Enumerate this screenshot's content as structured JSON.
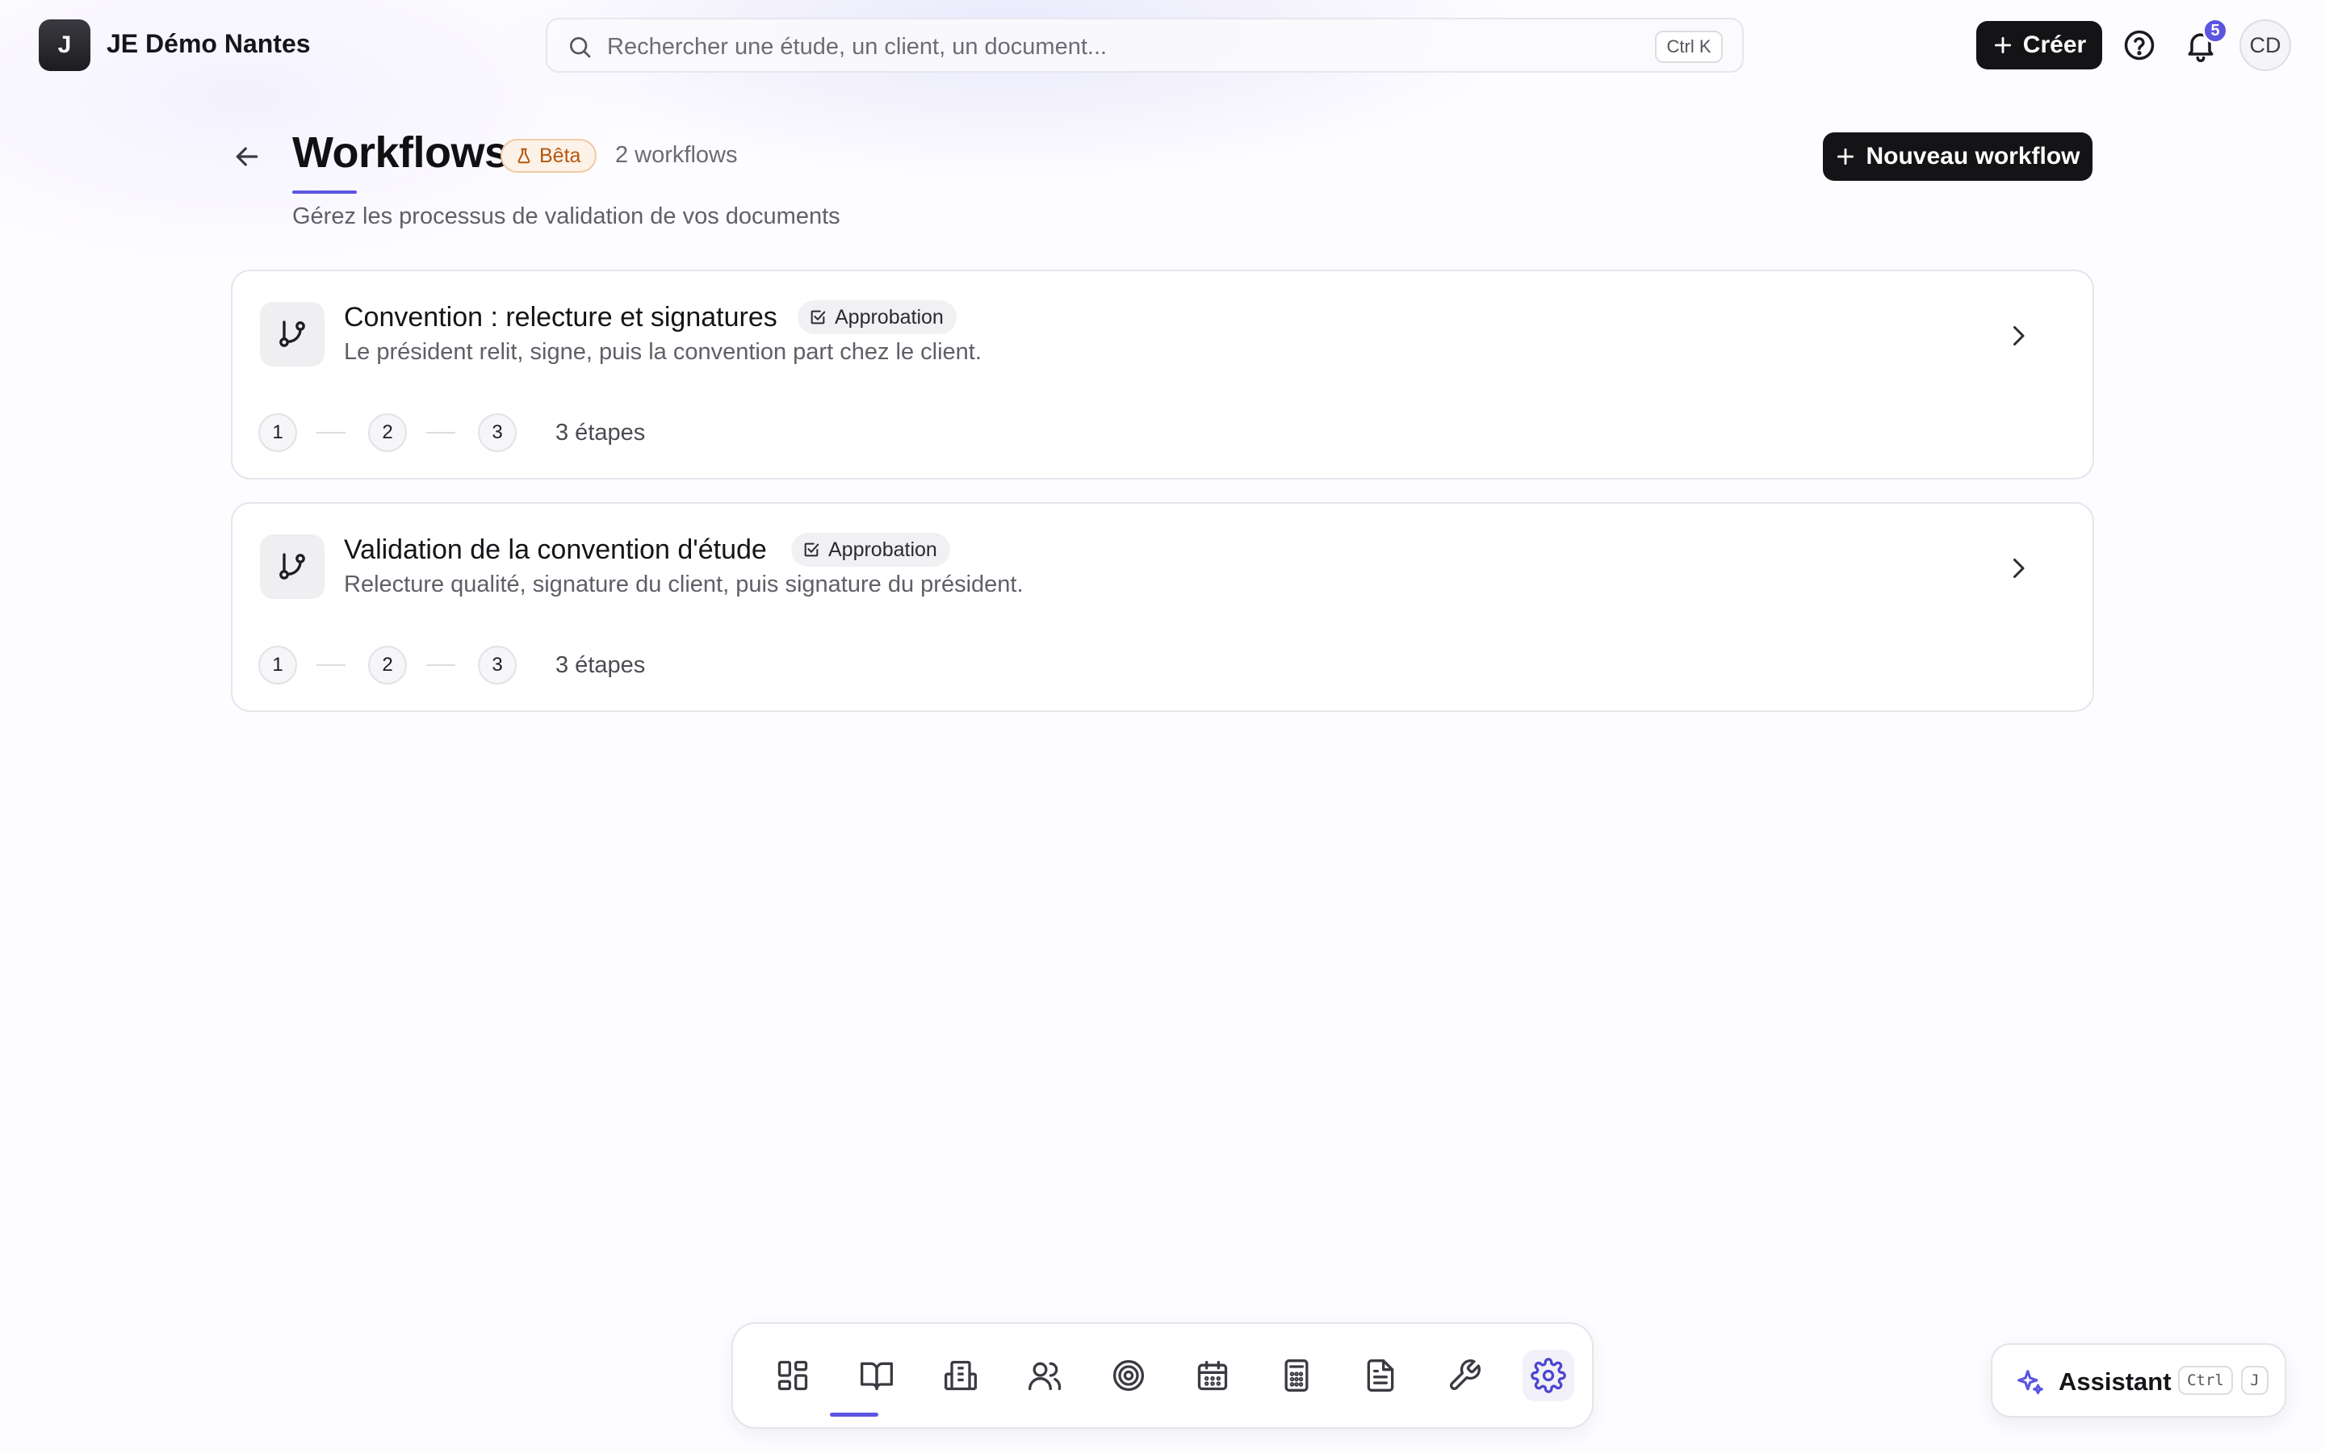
{
  "workspace": {
    "initial": "J",
    "name": "JE Démo Nantes"
  },
  "search": {
    "placeholder": "Rechercher une étude, un client, un document...",
    "shortcut": "Ctrl K"
  },
  "header_actions": {
    "create_label": "Créer",
    "notification_count": "5",
    "avatar_initials": "CD"
  },
  "page": {
    "title": "Workflows",
    "badge": "Bêta",
    "count": "2 workflows",
    "subtitle": "Gérez les processus de validation de vos documents",
    "new_button": "Nouveau workflow"
  },
  "workflows": [
    {
      "title": "Convention : relecture et signatures",
      "badge": "Approbation",
      "description": "Le président relit, signe, puis la convention part chez le client.",
      "steps": [
        "1",
        "2",
        "3"
      ],
      "steps_label": "3 étapes"
    },
    {
      "title": "Validation de la convention d'étude",
      "badge": "Approbation",
      "description": "Relecture qualité, signature du client, puis signature du président.",
      "steps": [
        "1",
        "2",
        "3"
      ],
      "steps_label": "3 étapes"
    }
  ],
  "dock": {
    "items": [
      "dashboard-icon",
      "book-icon",
      "building-icon",
      "users-icon",
      "target-icon",
      "calendar-icon",
      "calculator-icon",
      "document-icon",
      "wrench-icon",
      "settings-icon"
    ],
    "active": "settings-icon"
  },
  "assistant": {
    "label": "Assistant",
    "key_mod": "Ctrl",
    "key": "J"
  },
  "colors": {
    "accent": "#5b55e0",
    "primary_button": "#141417",
    "beta_text": "#b4570f",
    "beta_bg": "#fdf2e7"
  }
}
